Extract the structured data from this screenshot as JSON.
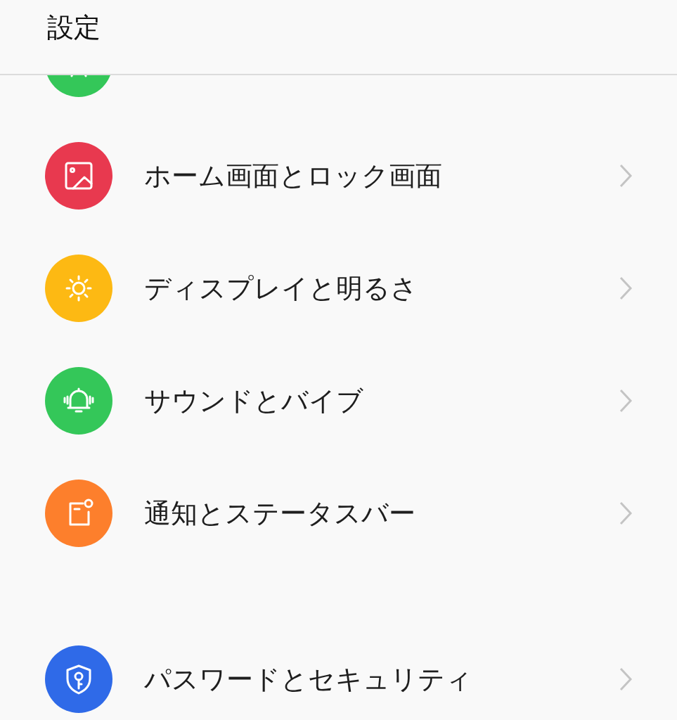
{
  "header": {
    "title": "設定"
  },
  "sections": [
    {
      "items": [
        {
          "kind": "clipped",
          "color": "#34c759"
        },
        {
          "kind": "picture",
          "color": "#e8394f",
          "label": "ホーム画面とロック画面"
        },
        {
          "kind": "sun",
          "color": "#fdb913",
          "label": "ディスプレイと明るさ"
        },
        {
          "kind": "bell",
          "color": "#34c759",
          "label": "サウンドとバイブ"
        },
        {
          "kind": "notification",
          "color": "#fd7f2c",
          "label": "通知とステータスバー"
        }
      ]
    },
    {
      "items": [
        {
          "kind": "shield-key",
          "color": "#2f6ae8",
          "label": "パスワードとセキュリティ"
        }
      ]
    }
  ]
}
